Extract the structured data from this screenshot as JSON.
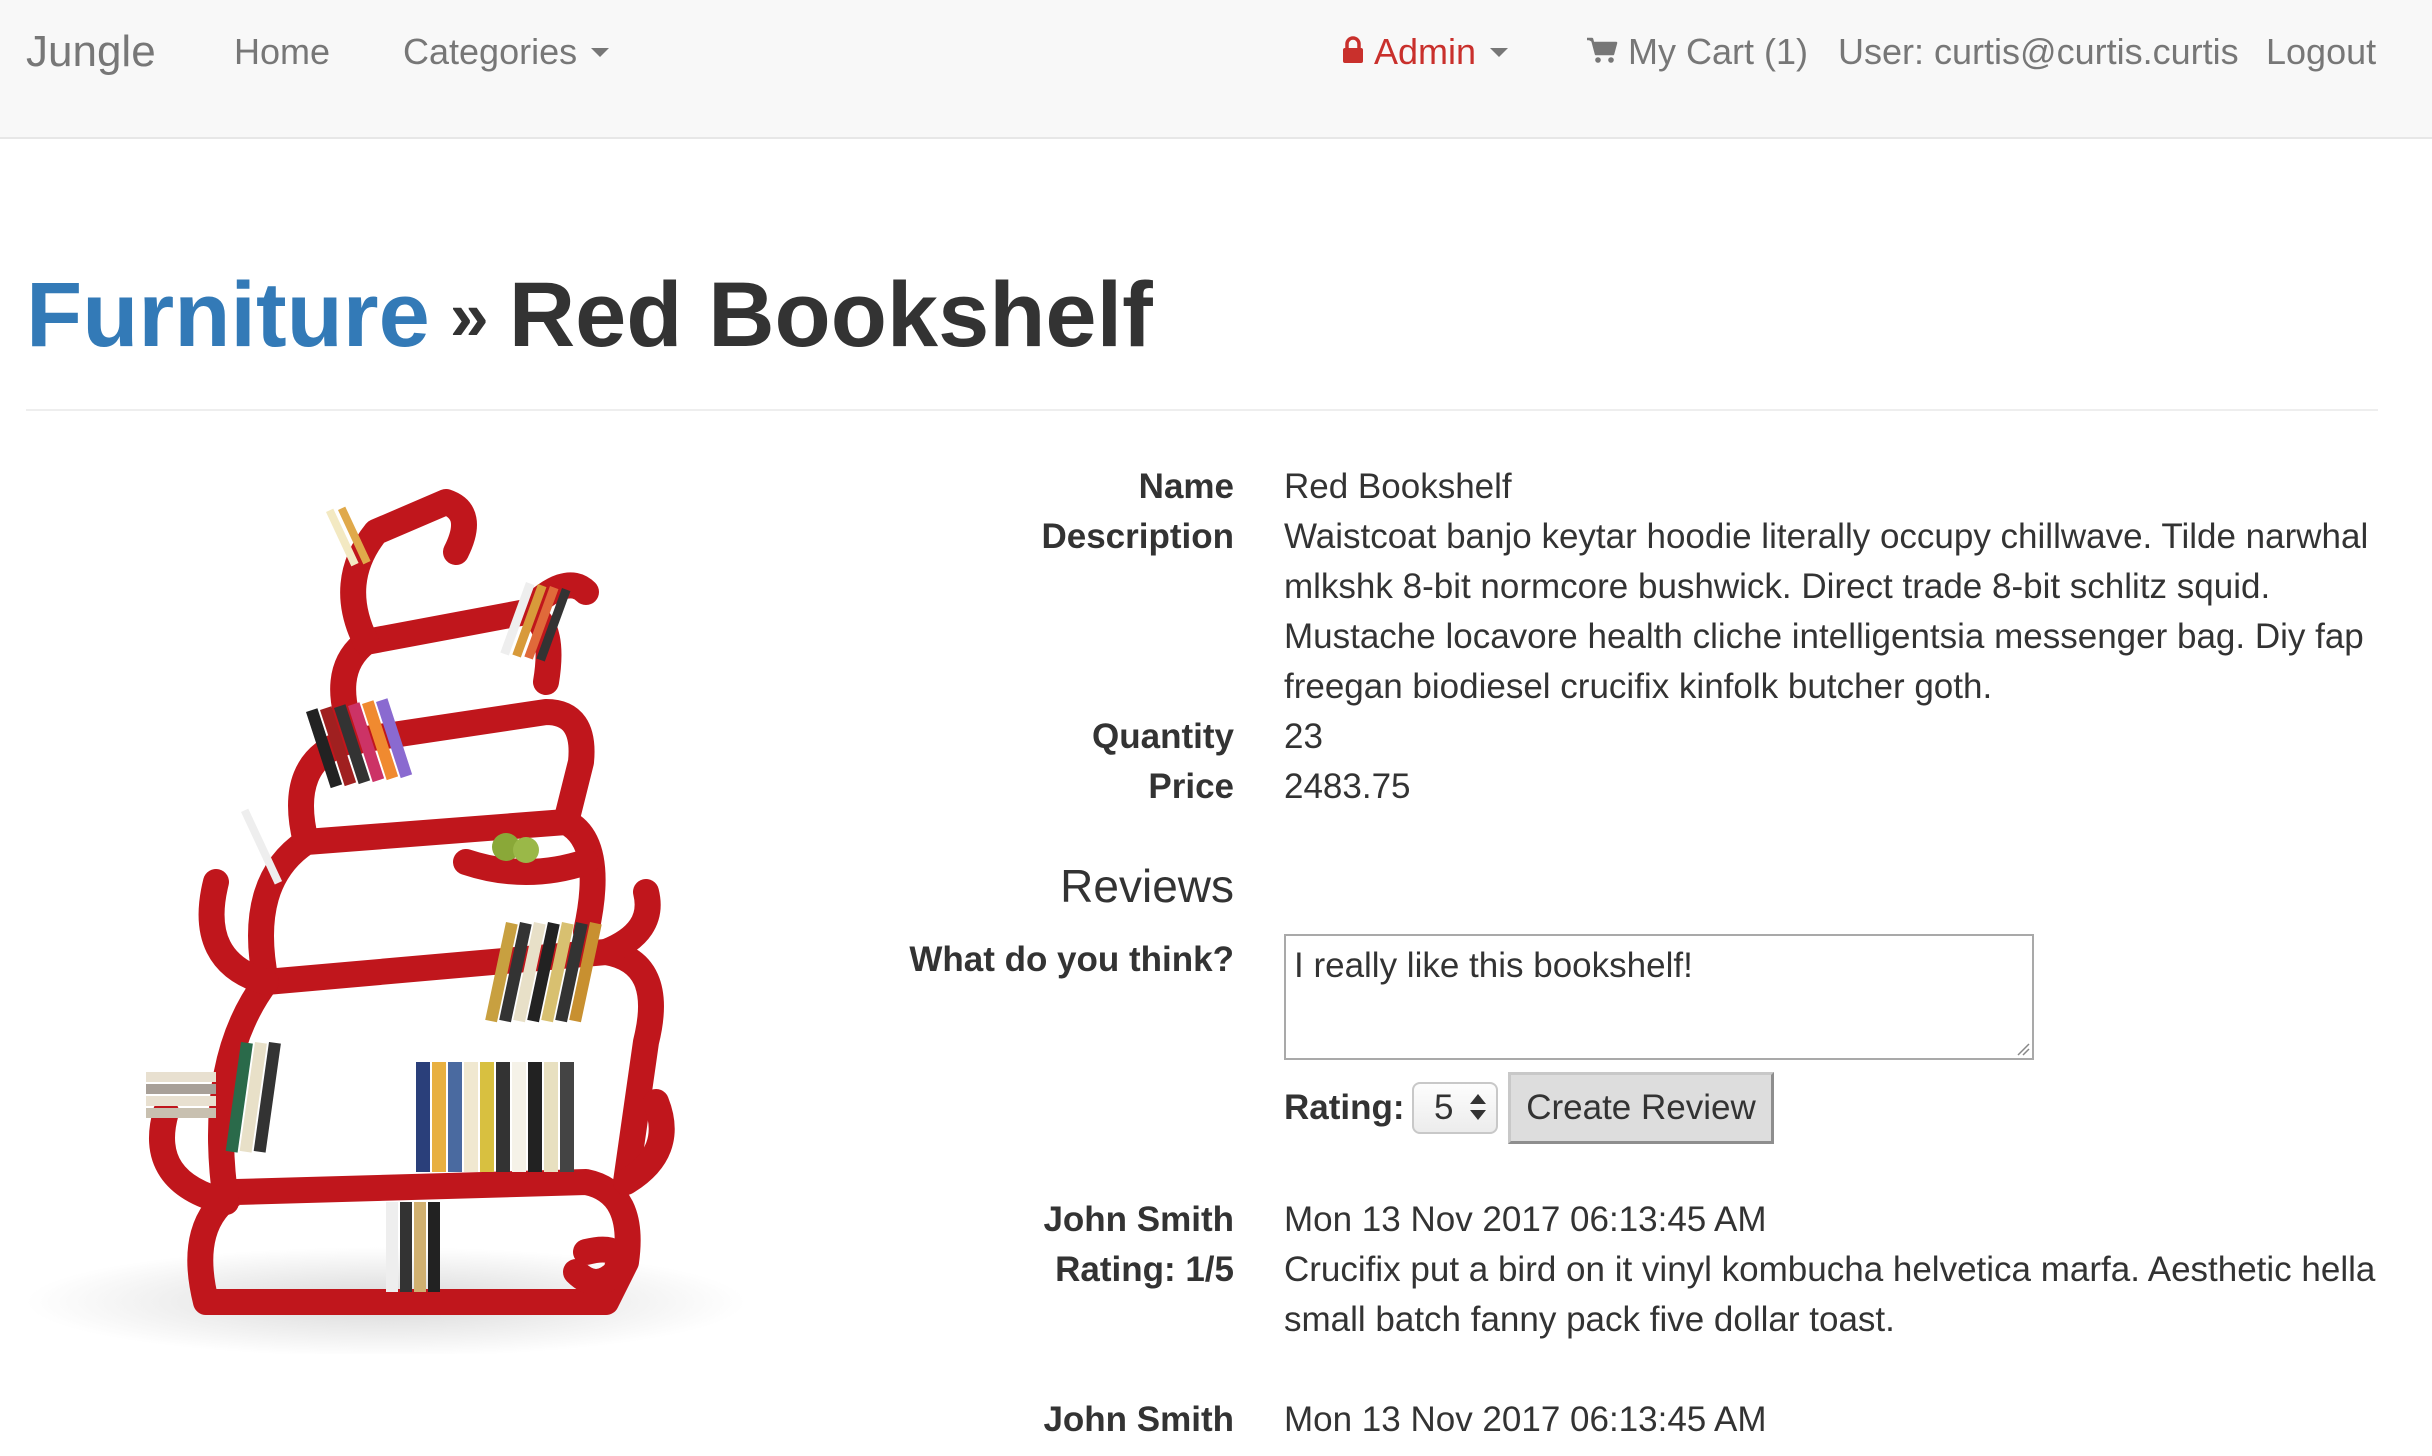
{
  "navbar": {
    "brand": "Jungle",
    "home": "Home",
    "categories": "Categories",
    "admin": "Admin",
    "cart": "My Cart (1)",
    "user": "User: curtis@curtis.curtis",
    "logout": "Logout",
    "admin_color": "#c9302c",
    "icons": {
      "lock": "lock-icon",
      "cart": "cart-icon",
      "caret": "caret-down-icon"
    }
  },
  "header": {
    "category": "Furniture",
    "separator": "»",
    "product_title": "Red Bookshelf",
    "link_color": "#337ab7"
  },
  "product": {
    "labels": {
      "name": "Name",
      "description": "Description",
      "quantity": "Quantity",
      "price": "Price"
    },
    "name": "Red Bookshelf",
    "description": "Waistcoat banjo keytar hoodie literally occupy chillwave. Tilde narwhal mlkshk 8-bit normcore bushwick. Direct trade 8-bit schlitz squid. Mustache locavore health cliche intelligentsia messenger bag. Diy fap freegan biodiesel crucifix kinfolk butcher goth.",
    "quantity": "23",
    "price": "2483.75",
    "image_color": "#c0161c"
  },
  "reviews": {
    "heading": "Reviews",
    "prompt_label": "What do you think?",
    "textarea_value": "I really like this bookshelf!",
    "rating_label": "Rating:",
    "rating_value": "5",
    "create_button": "Create Review",
    "items": [
      {
        "author": "John Smith",
        "rating": "Rating: 1/5",
        "date": "Mon 13 Nov 2017 06:13:45 AM",
        "text": "Crucifix put a bird on it vinyl kombucha helvetica marfa. Aesthetic hella small batch fanny pack five dollar toast."
      },
      {
        "author": "John Smith",
        "date": "Mon 13 Nov 2017 06:13:45 AM"
      }
    ]
  }
}
